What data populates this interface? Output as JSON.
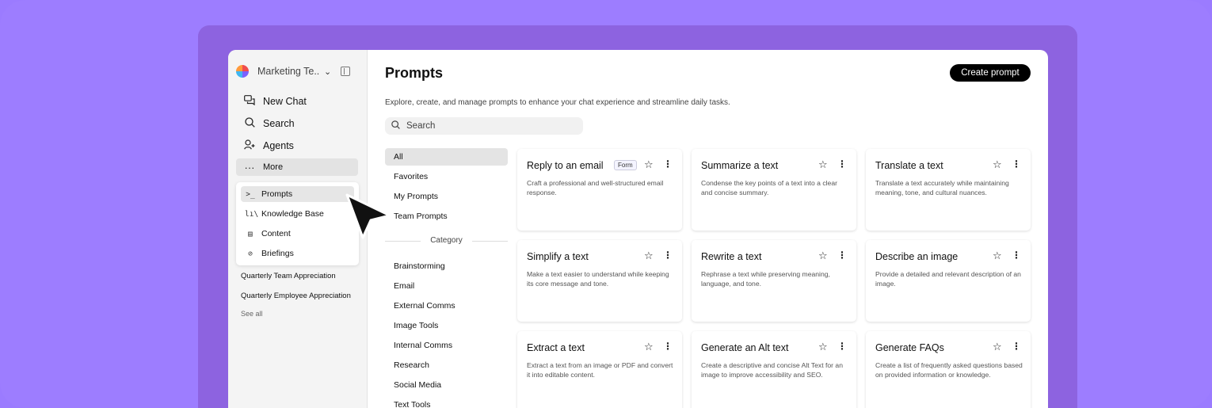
{
  "sidebar": {
    "workspace_name": "Marketing Te...",
    "nav": [
      {
        "label": "New Chat",
        "icon": "new-chat-icon"
      },
      {
        "label": "Search",
        "icon": "search-icon"
      },
      {
        "label": "Agents",
        "icon": "agents-icon"
      },
      {
        "label": "More",
        "icon": "more-icon"
      }
    ],
    "submenu": [
      {
        "label": "Prompts",
        "icon": "prompts-icon",
        "glyph": ">_"
      },
      {
        "label": "Knowledge Base",
        "icon": "knowledge-base-icon",
        "glyph": "lı\\"
      },
      {
        "label": "Content",
        "icon": "content-icon",
        "glyph": "▤"
      },
      {
        "label": "Briefings",
        "icon": "briefings-icon",
        "glyph": "⊘"
      }
    ],
    "recents": [
      "Quarterly Team Appreciation",
      "Quarterly Employee Appreciation"
    ],
    "see_all": "See all"
  },
  "header": {
    "title": "Prompts",
    "create_button": "Create prompt",
    "subtitle": "Explore, create, and manage prompts to enhance your chat experience and streamline daily tasks."
  },
  "search": {
    "placeholder": "Search"
  },
  "filters": [
    "All",
    "Favorites",
    "My Prompts",
    "Team Prompts"
  ],
  "category_label": "Category",
  "categories": [
    "Brainstorming",
    "Email",
    "External Comms",
    "Image Tools",
    "Internal Comms",
    "Research",
    "Social Media",
    "Text Tools"
  ],
  "cards": [
    {
      "title": "Reply to an email",
      "tag": "Form",
      "desc": "Craft a professional and well-structured email response."
    },
    {
      "title": "Summarize a text",
      "desc": "Condense the key points of a text into a clear and concise summary."
    },
    {
      "title": "Translate a text",
      "desc": "Translate a text accurately while maintaining meaning, tone, and cultural nuances."
    },
    {
      "title": "Simplify a text",
      "desc": "Make a text easier to understand while keeping its core message and tone."
    },
    {
      "title": "Rewrite a text",
      "desc": "Rephrase a text while preserving meaning, language, and tone."
    },
    {
      "title": "Describe an image",
      "desc": "Provide a detailed and relevant description of an image."
    },
    {
      "title": "Extract a text",
      "desc": "Extract a text from an image or PDF and convert it into editable content."
    },
    {
      "title": "Generate an Alt text",
      "desc": "Create a descriptive and concise Alt Text for an image to improve accessibility and SEO."
    },
    {
      "title": "Generate FAQs",
      "desc": "Create a list of frequently asked questions based on provided information or knowledge."
    }
  ],
  "colors": {
    "background": "#9d7dff",
    "backdrop": "#8d63e0",
    "sidebar": "#f4f4f4",
    "button": "#000000"
  }
}
